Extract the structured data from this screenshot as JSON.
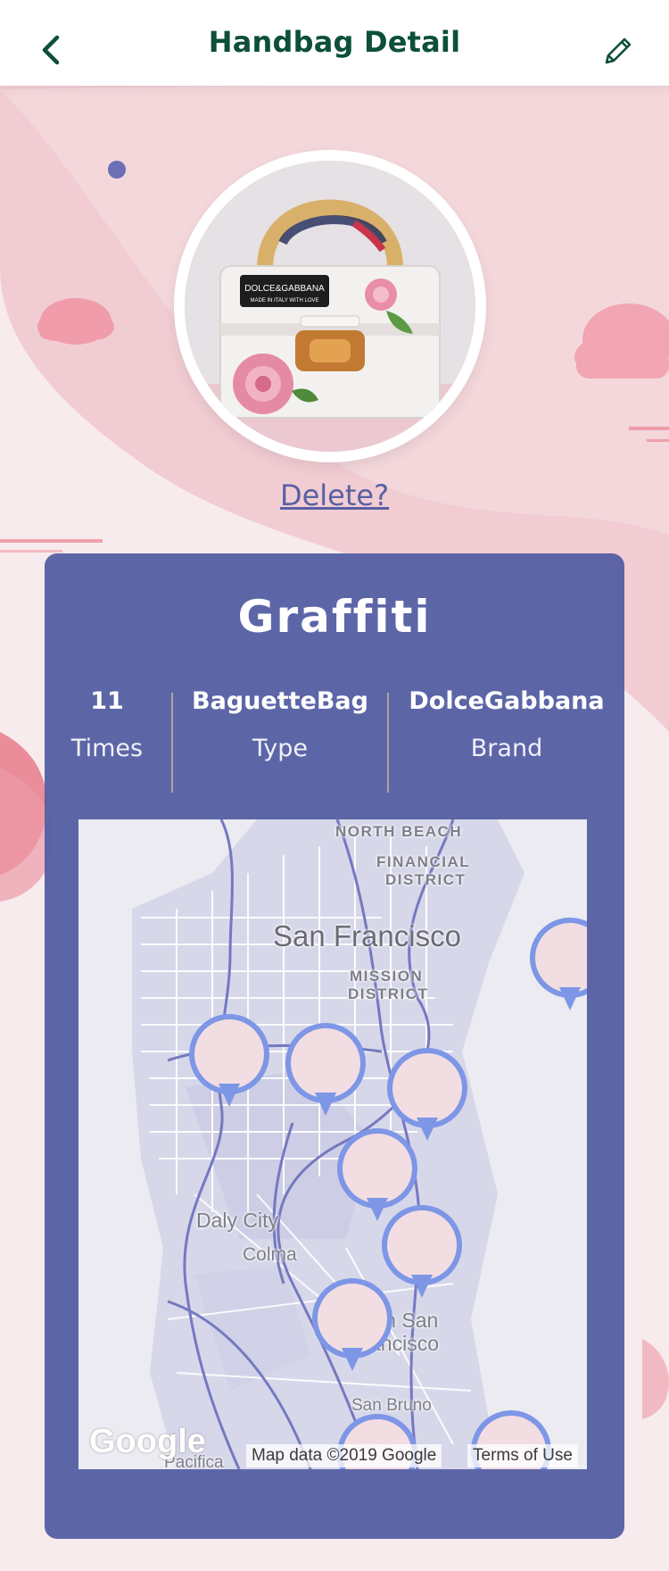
{
  "header": {
    "title": "Handbag Detail",
    "back_icon": "chevron-left-icon",
    "edit_icon": "pencil-icon"
  },
  "avatar": {
    "image": "handbag-photo"
  },
  "delete_label": "Delete?",
  "card": {
    "title": "Graffiti",
    "stats": [
      {
        "value": "11",
        "label": "Times"
      },
      {
        "value": "BaguetteBag",
        "label": "Type"
      },
      {
        "value": "DolceGabbana",
        "label": "Brand"
      }
    ]
  },
  "map": {
    "labels": {
      "north_beach": "NORTH BEACH",
      "financial_1": "FINANCIAL",
      "financial_2": "DISTRICT",
      "city": "San Francisco",
      "mission_1": "MISSION",
      "mission_2": "DISTRICT",
      "daly_city": "Daly City",
      "colma": "Colma",
      "ssf_1": "uth San",
      "ssf_2": "ancisco",
      "san_bruno": "San Bruno",
      "pacifica": "Pacifica",
      "e_fragment": "e"
    },
    "google": "Google",
    "attribution": "Map data ©2019 Google",
    "terms": "Terms of Use"
  },
  "colors": {
    "header_title": "#0d4f3b",
    "card_bg": "#525da3",
    "pin": "#7d96e6",
    "link": "#5960a3"
  }
}
